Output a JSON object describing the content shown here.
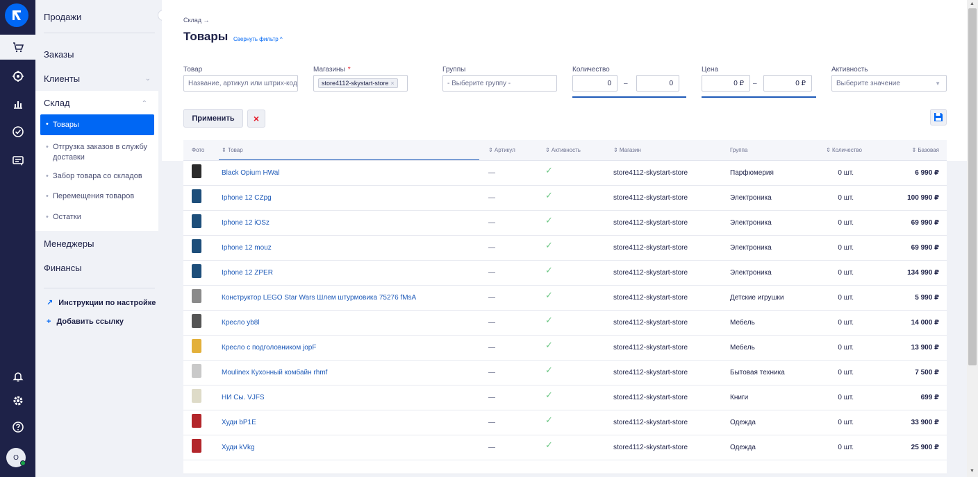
{
  "sidebar": {
    "sales": "Продажи",
    "orders": "Заказы",
    "clients": "Клиенты",
    "warehouse": "Склад",
    "sub": [
      "Товары",
      "Отгрузка заказов в службу доставки",
      "Забор товара со складов",
      "Перемещения товаров",
      "Остатки"
    ],
    "managers": "Менеджеры",
    "finance": "Финансы",
    "setup_link": "Инструкции по настройке",
    "add_link": "Добавить ссылку"
  },
  "rail": {
    "icons": [
      "logo-icon",
      "cart-icon",
      "target-icon",
      "chart-icon",
      "check-circle-icon",
      "chat-icon",
      "bell-icon",
      "gear-icon",
      "help-icon"
    ],
    "avatar": "O"
  },
  "header": {
    "breadcrumb": "Склад →",
    "title": "Товары",
    "fold_filter": "Свернуть фильтр ^"
  },
  "filters": {
    "product_label": "Товар",
    "product_placeholder": "Название, артикул или штрих-код",
    "stores_label": "Магазины",
    "stores_required": "*",
    "stores_tag": "store4112-skystart-store",
    "groups_label": "Группы",
    "groups_placeholder": "- Выберите группу -",
    "qty_label": "Количество",
    "qty_from": "0",
    "qty_to": "0",
    "range_dash": "–",
    "price_label": "Цена",
    "price_from": "0 ₽",
    "price_to": "0 ₽",
    "active_label": "Активность",
    "active_placeholder": "Выберите значение"
  },
  "actions": {
    "apply": "Применить",
    "clear": "×"
  },
  "table": {
    "headers": {
      "photo": "Фото",
      "product": "⇕ Товар",
      "article": "⇕ Артикул",
      "active": "⇕ Активность",
      "store": "⇕ Магазин",
      "group": "Группа",
      "qty": "⇕ Количество",
      "price": "⇕ Базовая"
    },
    "rows": [
      {
        "name": "Black Opium HWal",
        "article": "—",
        "store": "store4112-skystart-store",
        "group": "Парфюмерия",
        "qty": "0 шт.",
        "price": "6 990 ₽",
        "color": "#2b2b2b"
      },
      {
        "name": "Iphone 12 CZpg",
        "article": "—",
        "store": "store4112-skystart-store",
        "group": "Электроника",
        "qty": "0 шт.",
        "price": "100 990 ₽",
        "color": "#1d4e7a"
      },
      {
        "name": "Iphone 12 iOSz",
        "article": "—",
        "store": "store4112-skystart-store",
        "group": "Электроника",
        "qty": "0 шт.",
        "price": "69 990 ₽",
        "color": "#1d4e7a"
      },
      {
        "name": "Iphone 12 mouz",
        "article": "—",
        "store": "store4112-skystart-store",
        "group": "Электроника",
        "qty": "0 шт.",
        "price": "69 990 ₽",
        "color": "#1d4e7a"
      },
      {
        "name": "Iphone 12 ZPER",
        "article": "—",
        "store": "store4112-skystart-store",
        "group": "Электроника",
        "qty": "0 шт.",
        "price": "134 990 ₽",
        "color": "#1d4e7a"
      },
      {
        "name": "Конструктор LEGO Star Wars Шлем штурмовика 75276 fMsA",
        "article": "—",
        "store": "store4112-skystart-store",
        "group": "Детские игрушки",
        "qty": "0 шт.",
        "price": "5 990 ₽",
        "color": "#8a8a8a"
      },
      {
        "name": "Кресло yb8l",
        "article": "—",
        "store": "store4112-skystart-store",
        "group": "Мебель",
        "qty": "0 шт.",
        "price": "14 000 ₽",
        "color": "#555555"
      },
      {
        "name": "Кресло с подголовником jopF",
        "article": "—",
        "store": "store4112-skystart-store",
        "group": "Мебель",
        "qty": "0 шт.",
        "price": "13 900 ₽",
        "color": "#e3b03a"
      },
      {
        "name": "Moulinex Кухонный комбайн rhmf",
        "article": "—",
        "store": "store4112-skystart-store",
        "group": "Бытовая техника",
        "qty": "0 шт.",
        "price": "7 500 ₽",
        "color": "#c9c9c9"
      },
      {
        "name": "НИ Сы. VJFS",
        "article": "—",
        "store": "store4112-skystart-store",
        "group": "Книги",
        "qty": "0 шт.",
        "price": "699 ₽",
        "color": "#dedbc8"
      },
      {
        "name": "Худи bP1E",
        "article": "—",
        "store": "store4112-skystart-store",
        "group": "Одежда",
        "qty": "0 шт.",
        "price": "33 900 ₽",
        "color": "#b3262b"
      },
      {
        "name": "Худи kVkg",
        "article": "—",
        "store": "store4112-skystart-store",
        "group": "Одежда",
        "qty": "0 шт.",
        "price": "25 900 ₽",
        "color": "#b3262b"
      }
    ]
  }
}
